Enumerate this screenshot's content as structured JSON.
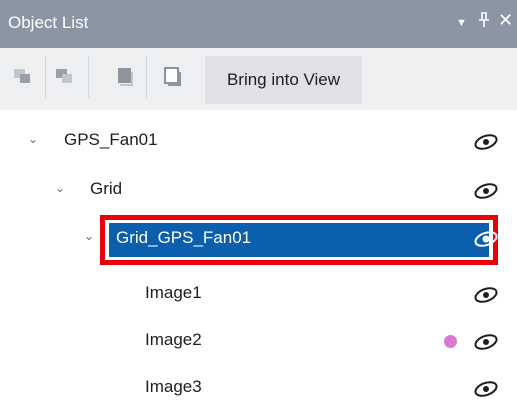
{
  "panel": {
    "title": "Object List",
    "title_icons": [
      "chevron-down-icon",
      "pin-icon",
      "close-icon"
    ],
    "glyphs": {
      "dropdown": "▼",
      "pin": "⊥",
      "close": "✕",
      "chevron": "⌄"
    }
  },
  "toolbar": {
    "buttons": [
      "bring-forward-icon",
      "send-backward-icon",
      "bring-to-front-icon",
      "send-to-back-icon"
    ],
    "bring_into_view_label": "Bring into View"
  },
  "tree": {
    "items": [
      {
        "label": "GPS_Fan01",
        "expanded": true,
        "visible": true
      },
      {
        "label": "Grid",
        "expanded": true,
        "visible": true
      },
      {
        "label": "Grid_GPS_Fan01",
        "expanded": true,
        "visible": true,
        "selected": true
      },
      {
        "label": "Image1",
        "visible": true
      },
      {
        "label": "Image2",
        "visible": true,
        "marker_color": "#dd77d4"
      },
      {
        "label": "Image3",
        "visible": true
      }
    ]
  },
  "colors": {
    "title_bar": "#8c95a3",
    "selection": "#0b5fad",
    "highlight_border": "#e8000b"
  }
}
